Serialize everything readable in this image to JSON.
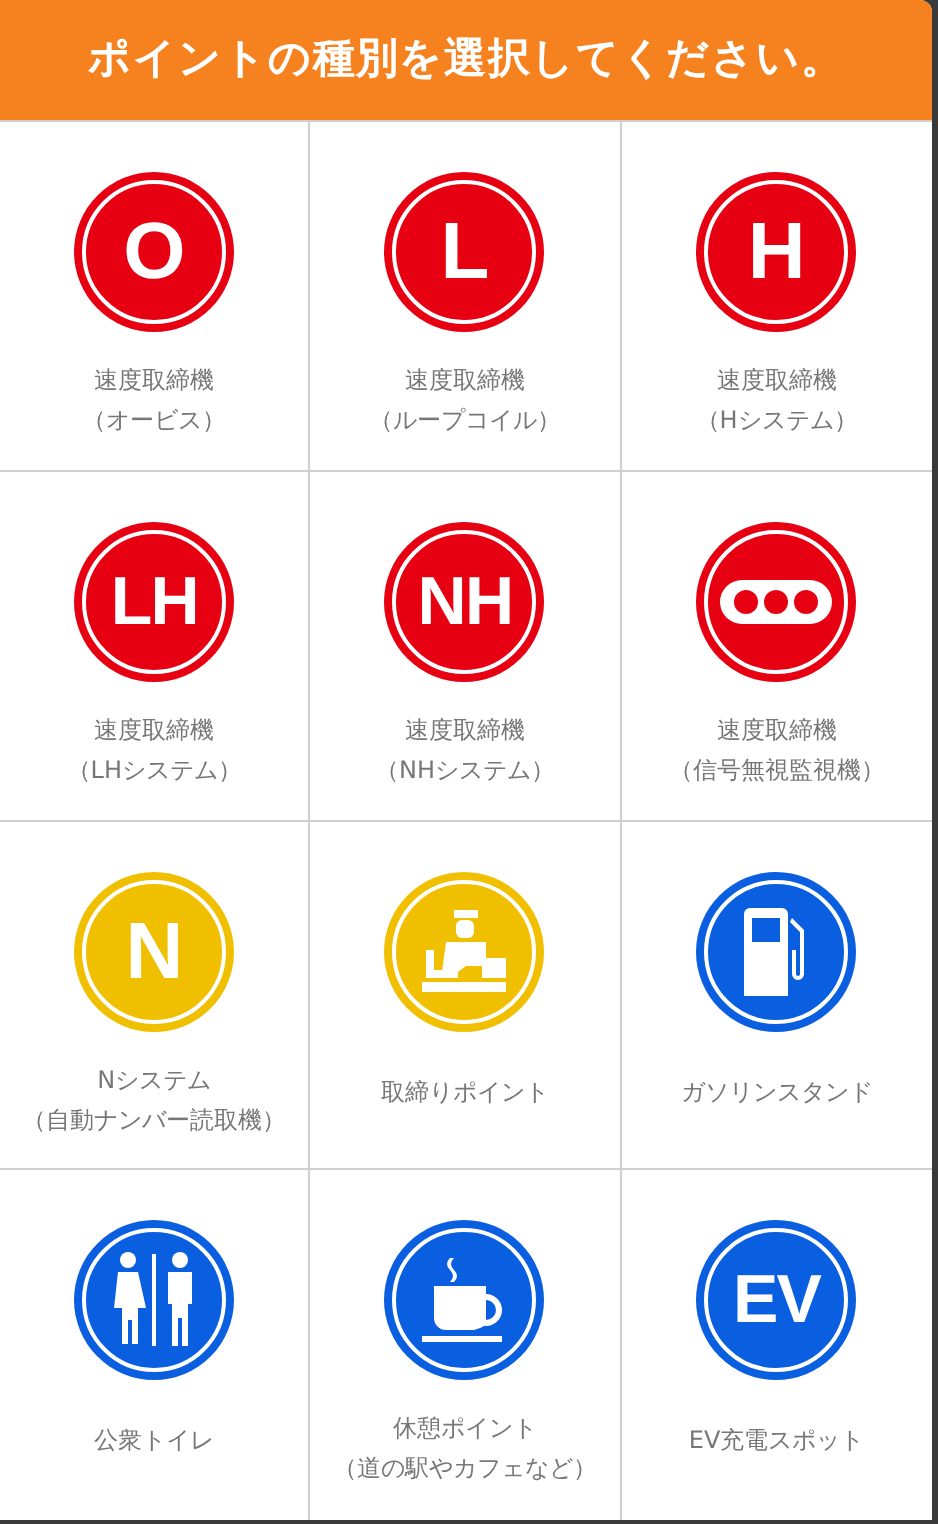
{
  "header": {
    "title": "ポイントの種別を選択してください。"
  },
  "items": [
    {
      "kind": "letter",
      "symbol": "O",
      "color": "#e60012",
      "lines": [
        "速度取締機",
        "（オービス）"
      ]
    },
    {
      "kind": "letter",
      "symbol": "L",
      "color": "#e60012",
      "lines": [
        "速度取締機",
        "（ループコイル）"
      ]
    },
    {
      "kind": "letter",
      "symbol": "H",
      "color": "#e60012",
      "lines": [
        "速度取締機",
        "（Hシステム）"
      ]
    },
    {
      "kind": "letter",
      "symbol": "LH",
      "color": "#e60012",
      "lines": [
        "速度取締機",
        "（LHシステム）"
      ]
    },
    {
      "kind": "letter",
      "symbol": "NH",
      "color": "#e60012",
      "lines": [
        "速度取締機",
        "（NHシステム）"
      ]
    },
    {
      "kind": "signal",
      "color": "#e60012",
      "lines": [
        "速度取締機",
        "（信号無視監視機）"
      ]
    },
    {
      "kind": "letter",
      "symbol": "N",
      "color": "#f0c000",
      "lines": [
        "Nシステム",
        "（自動ナンバー読取機）"
      ]
    },
    {
      "kind": "officer",
      "color": "#f0c000",
      "lines": [
        "取締りポイント"
      ]
    },
    {
      "kind": "fuel",
      "color": "#0a5fe0",
      "lines": [
        "ガソリンスタンド"
      ]
    },
    {
      "kind": "restroom",
      "color": "#0a5fe0",
      "lines": [
        "公衆トイレ"
      ]
    },
    {
      "kind": "coffee",
      "color": "#0a5fe0",
      "lines": [
        "休憩ポイント",
        "（道の駅やカフェなど）"
      ]
    },
    {
      "kind": "letter",
      "symbol": "EV",
      "color": "#0a5fe0",
      "lines": [
        "EV充電スポット"
      ]
    }
  ]
}
